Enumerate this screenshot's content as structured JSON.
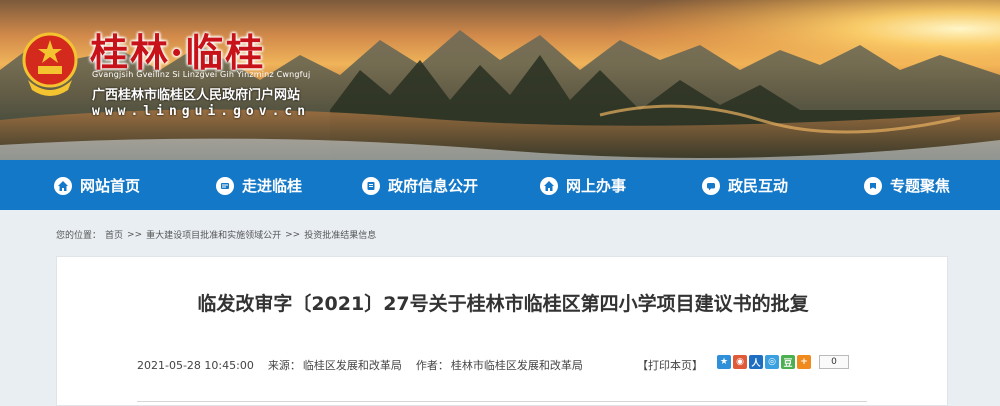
{
  "header": {
    "title": "桂林·临桂",
    "pinyin": "Gvangjsih Gveilinz Si Linzgvei Gih Yinzminz Cwngfuj",
    "subtitle": "广西桂林市临桂区人民政府门户网站",
    "url": "www.lingui.gov.cn"
  },
  "nav": {
    "items": [
      {
        "label": "网站首页",
        "icon": "home-icon"
      },
      {
        "label": "走进临桂",
        "icon": "info-icon"
      },
      {
        "label": "政府信息公开",
        "icon": "document-icon"
      },
      {
        "label": "网上办事",
        "icon": "home-icon"
      },
      {
        "label": "政民互动",
        "icon": "chat-icon"
      },
      {
        "label": "专题聚焦",
        "icon": "topic-icon"
      }
    ]
  },
  "breadcrumb": {
    "prefix": "您的位置：",
    "items": [
      "首页",
      "重大建设项目批准和实施领域公开",
      "投资批准结果信息"
    ],
    "separator": ">>"
  },
  "article": {
    "title": "临发改审字〔2021〕27号关于桂林市临桂区第四小学项目建议书的批复",
    "date": "2021-05-28 10:45:00",
    "source_label": "来源：",
    "source": "临桂区发展和改革局",
    "author_label": "作者：",
    "author": "桂林市临桂区发展和改革局",
    "print_label": "【打印本页】",
    "share_count": "0"
  },
  "colors": {
    "nav_bg": "#1478c8",
    "title_red": "#c8121a"
  }
}
